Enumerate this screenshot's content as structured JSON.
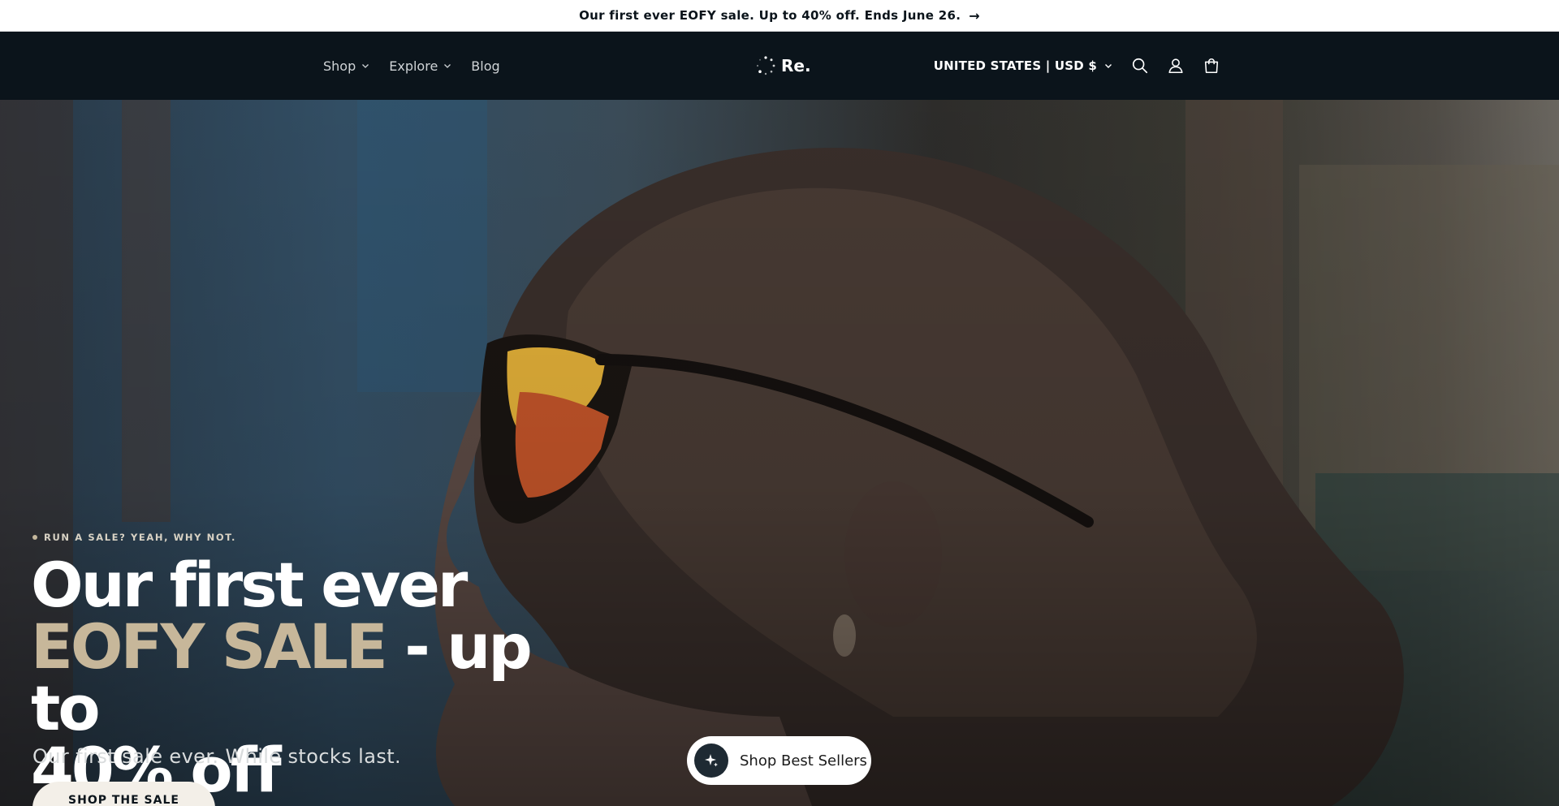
{
  "announcement": {
    "text": "Our first ever EOFY sale. Up to 40% off. Ends June 26.",
    "arrow_icon": "arrow-right-icon"
  },
  "header": {
    "nav": [
      {
        "label": "Shop",
        "has_dropdown": true
      },
      {
        "label": "Explore",
        "has_dropdown": true
      },
      {
        "label": "Blog",
        "has_dropdown": false
      }
    ],
    "logo_text": "Re.",
    "country_selector": "UNITED STATES | USD $",
    "icons": [
      "search-icon",
      "account-icon",
      "cart-icon"
    ]
  },
  "hero": {
    "eyebrow": "RUN A SALE? YEAH, WHY NOT.",
    "headline_line1": "Our first ever",
    "headline_accent": "EOFY SALE",
    "headline_line2_rest": " - up to",
    "headline_line3": "40% off",
    "subhead": "Our first sale ever. While stocks last.",
    "cta_label": "SHOP THE SALE",
    "floating_button_label": "Shop Best Sellers"
  },
  "colors": {
    "header_bg": "#0b141b",
    "accent_text": "#c7b79a",
    "cta_bg": "#f3efe8"
  }
}
